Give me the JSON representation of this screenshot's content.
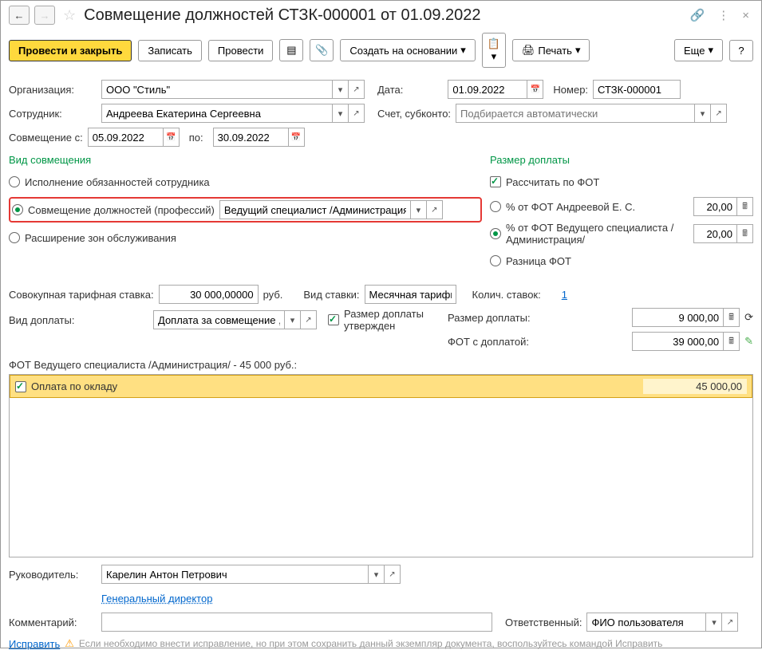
{
  "header": {
    "title": "Совмещение должностей СТЗК-000001 от 01.09.2022"
  },
  "toolbar": {
    "post_close": "Провести и закрыть",
    "save": "Записать",
    "post": "Провести",
    "create_based": "Создать на основании",
    "print": "Печать",
    "more": "Еще",
    "help": "?"
  },
  "fields": {
    "org_label": "Организация:",
    "org_value": "ООО \"Стиль\"",
    "date_label": "Дата:",
    "date_value": "01.09.2022",
    "number_label": "Номер:",
    "number_value": "СТЗК-000001",
    "employee_label": "Сотрудник:",
    "employee_value": "Андреева Екатерина Сергеевна",
    "account_label": "Счет, субконто:",
    "account_placeholder": "Подбирается автоматически",
    "combine_from_label": "Совмещение с:",
    "combine_from": "05.09.2022",
    "to_label": "по:",
    "combine_to": "30.09.2022"
  },
  "combination": {
    "title": "Вид совмещения",
    "opt1": "Исполнение обязанностей сотрудника",
    "opt2": "Совмещение должностей (профессий)",
    "opt2_value": "Ведущий специалист /Администрация/",
    "opt3": "Расширение зон обслуживания"
  },
  "supplement": {
    "title": "Размер доплаты",
    "calc_fot": "Рассчитать по ФОТ",
    "pct_employee": "% от ФОТ Андреевой Е. С.",
    "pct_employee_val": "20,00",
    "pct_position": "% от ФОТ Ведущего специалиста /Администрация/",
    "pct_position_val": "20,00",
    "diff": "Разница ФОТ"
  },
  "mid": {
    "rate_label": "Совокупная тарифная ставка:",
    "rate_value": "30 000,00000",
    "rate_unit": "руб.",
    "rate_type_label": "Вид ставки:",
    "rate_type_value": "Месячная тарифн",
    "count_label": "Колич. ставок:",
    "count_value": "1",
    "suppl_type_label": "Вид доплаты:",
    "suppl_type_value": "Доплата за совмещение ,",
    "approved": "Размер доплаты утвержден",
    "suppl_size_label": "Размер доплаты:",
    "suppl_size_value": "9 000,00",
    "fot_total_label": "ФОТ с доплатой:",
    "fot_total_value": "39 000,00"
  },
  "fot": {
    "title": "ФОТ Ведущего специалиста /Администрация/ - 45 000 руб.:",
    "row_label": "Оплата по окладу",
    "row_value": "45 000,00"
  },
  "footer": {
    "manager_label": "Руководитель:",
    "manager_value": "Карелин Антон Петрович",
    "manager_position": "Генеральный директор",
    "comment_label": "Комментарий:",
    "responsible_label": "Ответственный:",
    "responsible_value": "ФИО пользователя",
    "fix_link": "Исправить",
    "warning": "Если необходимо внести исправление, но при этом сохранить данный экземпляр документа, воспользуйтесь командой Исправить"
  }
}
